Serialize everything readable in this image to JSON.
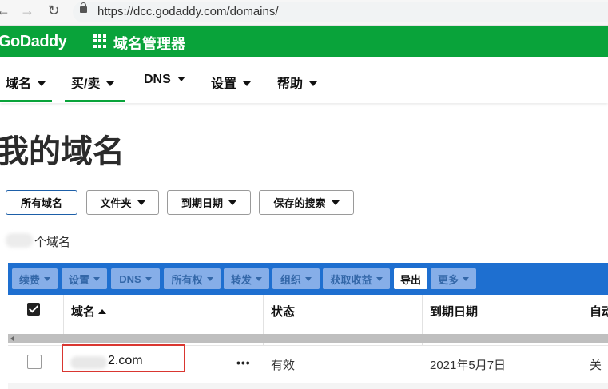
{
  "browser": {
    "back_glyph": "←",
    "forward_glyph": "→",
    "reload_glyph": "↻",
    "url": "https://dcc.godaddy.com/domains/"
  },
  "header": {
    "logo": "GoDaddy",
    "app_title": "域名管理器",
    "color": "#09a33a"
  },
  "nav": {
    "items": [
      {
        "label": "域名"
      },
      {
        "label": "买/卖"
      },
      {
        "label": "DNS"
      },
      {
        "label": "设置"
      },
      {
        "label": "帮助"
      }
    ]
  },
  "page": {
    "title": "我的域名"
  },
  "filters": {
    "all_domains": "所有域名",
    "folder": "文件夹",
    "expiry_date": "到期日期",
    "saved_search": "保存的搜索"
  },
  "count": {
    "suffix": "个域名"
  },
  "toolbar": {
    "color": "#1e6fd0",
    "renew": "续费",
    "settings": "设置",
    "dns": "DNS",
    "ownership": "所有权",
    "forward": "转发",
    "organize": "组织",
    "monetize": "获取收益",
    "export": "导出",
    "more": "更多"
  },
  "table": {
    "columns": {
      "domain": "域名",
      "status": "状态",
      "expiry": "到期日期",
      "auto": "自动"
    },
    "rows": [
      {
        "domain_suffix": "2.com",
        "actions": "•••",
        "status": "有效",
        "expiry": "2021年5月7日",
        "auto": "关"
      }
    ]
  }
}
